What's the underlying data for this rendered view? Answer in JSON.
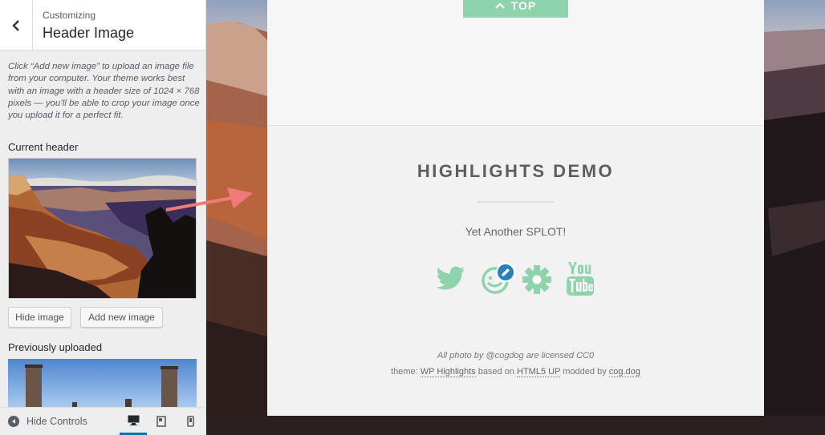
{
  "sidebar": {
    "crumb": "Customizing",
    "title": "Header Image",
    "description": "Click “Add new image” to upload an image file from your computer. Your theme works best with an image with a header size of 1024 × 768 pixels — you’ll be able to crop your image once you upload it for a perfect fit.",
    "current_header_label": "Current header",
    "hide_image_label": "Hide image",
    "add_new_image_label": "Add new image",
    "previously_uploaded_label": "Previously uploaded",
    "hide_controls_label": "Hide Controls",
    "devices": [
      "desktop-icon",
      "tablet-icon",
      "mobile-icon"
    ],
    "active_device": "desktop"
  },
  "preview": {
    "top_button_label": "TOP",
    "site_title": "HIGHLIGHTS DEMO",
    "tagline": "Yet Another SPLOT!",
    "social_icons": [
      "twitter-icon",
      "splot-edit-icon",
      "gear-icon",
      "youtube-icon"
    ],
    "credit": "All photo by @cogdog are licensed CC0",
    "theme_prefix": "theme: ",
    "theme_link": "WP Highlights",
    "based_on": " based on ",
    "html5up_link": "HTML5 UP",
    "modded_by": " modded by ",
    "cogdog_link": "cog.dog"
  },
  "colors": {
    "accent_green": "#8fd3ad",
    "wp_blue": "#0073aa",
    "annotation_arrow": "#f07a7a"
  }
}
